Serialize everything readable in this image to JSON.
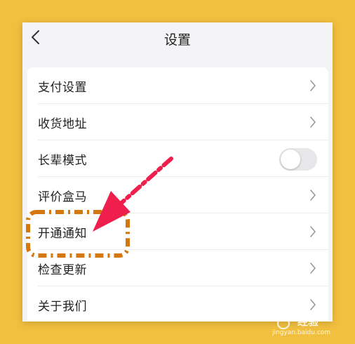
{
  "header": {
    "title": "设置"
  },
  "settings": {
    "items": [
      {
        "label": "支付设置",
        "control": "chevron"
      },
      {
        "label": "收货地址",
        "control": "chevron"
      },
      {
        "label": "长辈模式",
        "control": "toggle",
        "toggle_on": false
      },
      {
        "label": "评价盒马",
        "control": "chevron"
      },
      {
        "label": "开通通知",
        "control": "chevron"
      },
      {
        "label": "检查更新",
        "control": "chevron"
      },
      {
        "label": "关于我们",
        "control": "chevron"
      }
    ]
  },
  "annotation": {
    "arrow_color": "#ee1f4d",
    "highlight_box_color": "#d4770f",
    "highlighted_item": "开通通知"
  },
  "watermark": {
    "brand": "经验",
    "url": "jingyan.baidu.com"
  },
  "colors": {
    "background": "#f2c03f",
    "screen": "#f4f3f5",
    "card": "#ffffff"
  }
}
